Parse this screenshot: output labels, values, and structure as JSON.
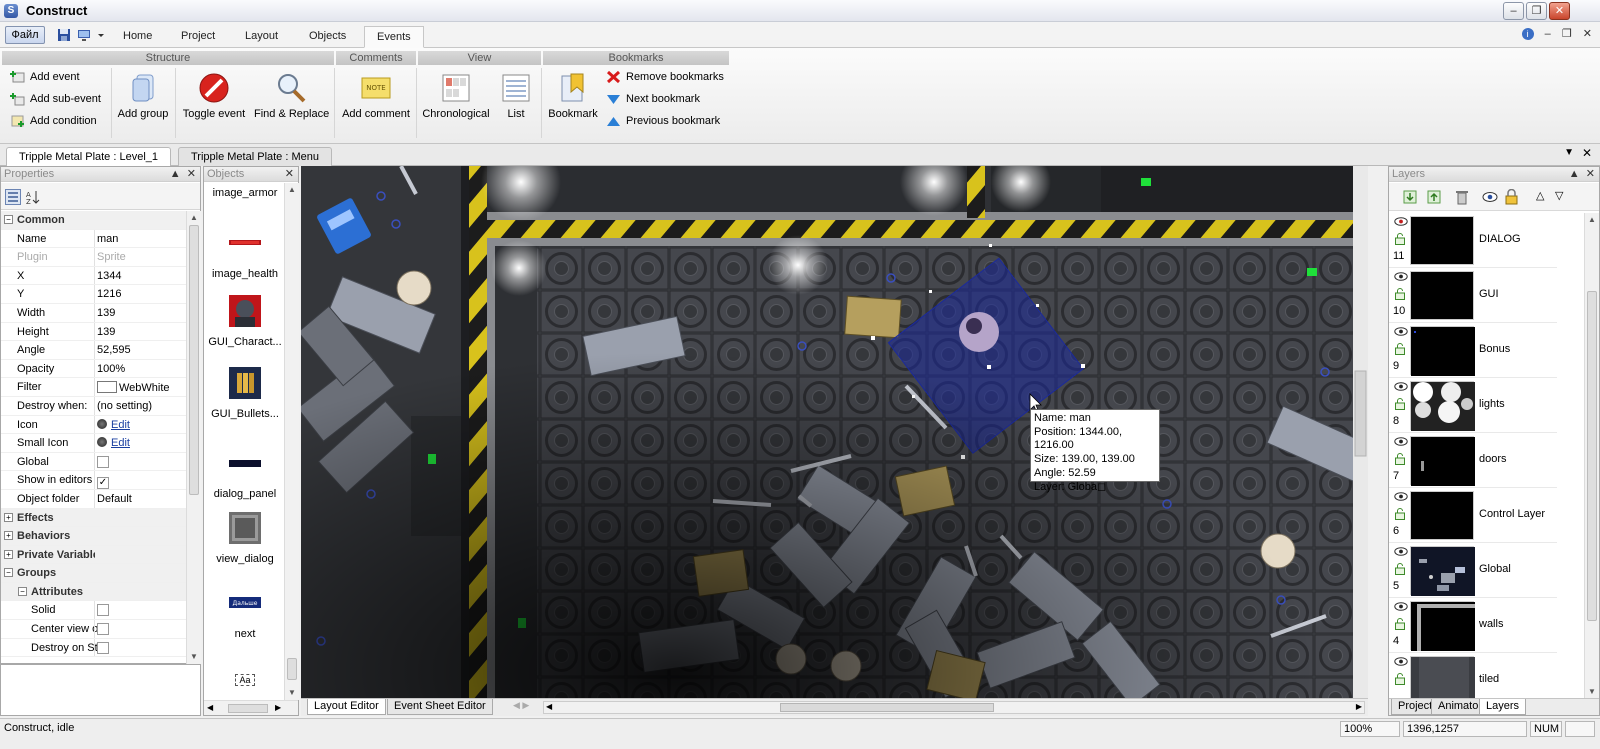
{
  "window": {
    "title": "Construct"
  },
  "menu": {
    "file_label": "Файл",
    "tabs": [
      "Home",
      "Project",
      "Layout",
      "Objects",
      "Events"
    ],
    "active_tab": "Events"
  },
  "ribbon": {
    "groups": {
      "structure": "Structure",
      "comments": "Comments",
      "view": "View",
      "bookmarks": "Bookmarks"
    },
    "add_event": "Add event",
    "add_sub_event": "Add sub-event",
    "add_condition": "Add condition",
    "add_group": "Add group",
    "toggle_event": "Toggle event",
    "find_replace": "Find & Replace",
    "add_comment": "Add comment",
    "chronological": "Chronological",
    "list": "List",
    "bookmark": "Bookmark",
    "remove_bookmarks": "Remove bookmarks",
    "next_bookmark": "Next bookmark",
    "previous_bookmark": "Previous bookmark",
    "note_text": "NOTE"
  },
  "doc_tabs": [
    "Tripple Metal Plate : Level_1",
    "Tripple Metal Plate : Menu"
  ],
  "properties": {
    "title": "Properties",
    "rows": [
      {
        "name": "Common",
        "kind": "category",
        "expander": "−"
      },
      {
        "name": "Name",
        "value": "man"
      },
      {
        "name": "Plugin",
        "value": "Sprite",
        "dim": true
      },
      {
        "name": "X",
        "value": "1344"
      },
      {
        "name": "Y",
        "value": "1216"
      },
      {
        "name": "Width",
        "value": "139"
      },
      {
        "name": "Height",
        "value": "139"
      },
      {
        "name": "Angle",
        "value": "52,595"
      },
      {
        "name": "Opacity",
        "value": "100%"
      },
      {
        "name": "Filter",
        "value": "WebWhite",
        "swatch": true
      },
      {
        "name": "Destroy when:",
        "value": "(no setting)"
      },
      {
        "name": "Icon",
        "value": "Edit",
        "link": true
      },
      {
        "name": "Small Icon",
        "value": "Edit",
        "link": true
      },
      {
        "name": "Global",
        "value": "",
        "check": ""
      },
      {
        "name": "Show in editors",
        "value": "",
        "check": "✓"
      },
      {
        "name": "Object folder",
        "value": "Default"
      },
      {
        "name": "Effects",
        "kind": "category",
        "expander": "+"
      },
      {
        "name": "Behaviors",
        "kind": "category",
        "expander": "+"
      },
      {
        "name": "Private Variables",
        "kind": "category",
        "expander": "+"
      },
      {
        "name": "Groups",
        "kind": "category",
        "expander": "−"
      },
      {
        "name": "Attributes",
        "kind": "subcategory",
        "expander": "−"
      },
      {
        "name": "Solid",
        "value": "",
        "check": "",
        "sub": true
      },
      {
        "name": "Center view o",
        "value": "",
        "check": "",
        "sub": true
      },
      {
        "name": "Destroy on St",
        "value": "",
        "check": "",
        "sub": true
      }
    ]
  },
  "objects": {
    "title": "Objects",
    "items": [
      "image_armor",
      "image_health",
      "GUI_Charact...",
      "GUI_Bullets...",
      "dialog_panel",
      "view_dialog",
      "next"
    ],
    "next_thumb_text": "Дальше",
    "last_thumb_text": "Aa"
  },
  "canvas": {
    "tooltip": [
      "Name: man",
      "Position: 1344.00, 1216.00",
      "Size: 139.00, 139.00",
      "Angle: 52.59",
      "Layer: Globa◻"
    ]
  },
  "bottom_tabs": [
    "Layout Editor",
    "Event Sheet Editor"
  ],
  "layers": {
    "title": "Layers",
    "items": [
      {
        "name": "DIALOG",
        "num": "11"
      },
      {
        "name": "GUI",
        "num": "10"
      },
      {
        "name": "Bonus",
        "num": "9"
      },
      {
        "name": "lights",
        "num": "8"
      },
      {
        "name": "doors",
        "num": "7"
      },
      {
        "name": "Control Layer",
        "num": "6"
      },
      {
        "name": "Global",
        "num": "5"
      },
      {
        "name": "walls",
        "num": "4"
      },
      {
        "name": "tiled",
        "num": ""
      }
    ],
    "tabs": [
      "Project",
      "Animator",
      "Layers"
    ]
  },
  "status": {
    "text": "Construct, idle",
    "zoom": "100%",
    "coords": "1396,1257",
    "num": "NUM"
  },
  "colors": {
    "accent": "#1a3fa0",
    "hazard_yellow": "#d8c21c",
    "selection": "#1b2a9c"
  }
}
